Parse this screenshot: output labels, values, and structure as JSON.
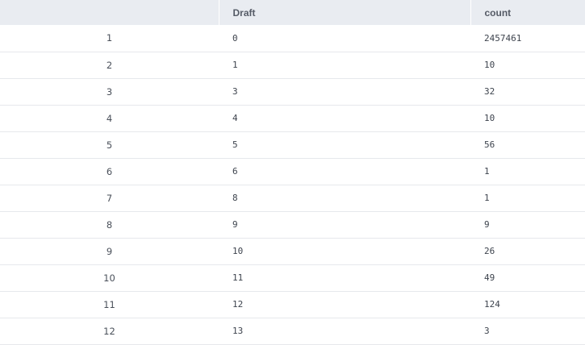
{
  "table": {
    "columns": [
      "",
      "Draft",
      "count"
    ],
    "rows": [
      {
        "index": "1",
        "draft": "0",
        "count": "2457461"
      },
      {
        "index": "2",
        "draft": "1",
        "count": "10"
      },
      {
        "index": "3",
        "draft": "3",
        "count": "32"
      },
      {
        "index": "4",
        "draft": "4",
        "count": "10"
      },
      {
        "index": "5",
        "draft": "5",
        "count": "56"
      },
      {
        "index": "6",
        "draft": "6",
        "count": "1"
      },
      {
        "index": "7",
        "draft": "8",
        "count": "1"
      },
      {
        "index": "8",
        "draft": "9",
        "count": "9"
      },
      {
        "index": "9",
        "draft": "10",
        "count": "26"
      },
      {
        "index": "10",
        "draft": "11",
        "count": "49"
      },
      {
        "index": "11",
        "draft": "12",
        "count": "124"
      },
      {
        "index": "12",
        "draft": "13",
        "count": "3"
      }
    ]
  }
}
